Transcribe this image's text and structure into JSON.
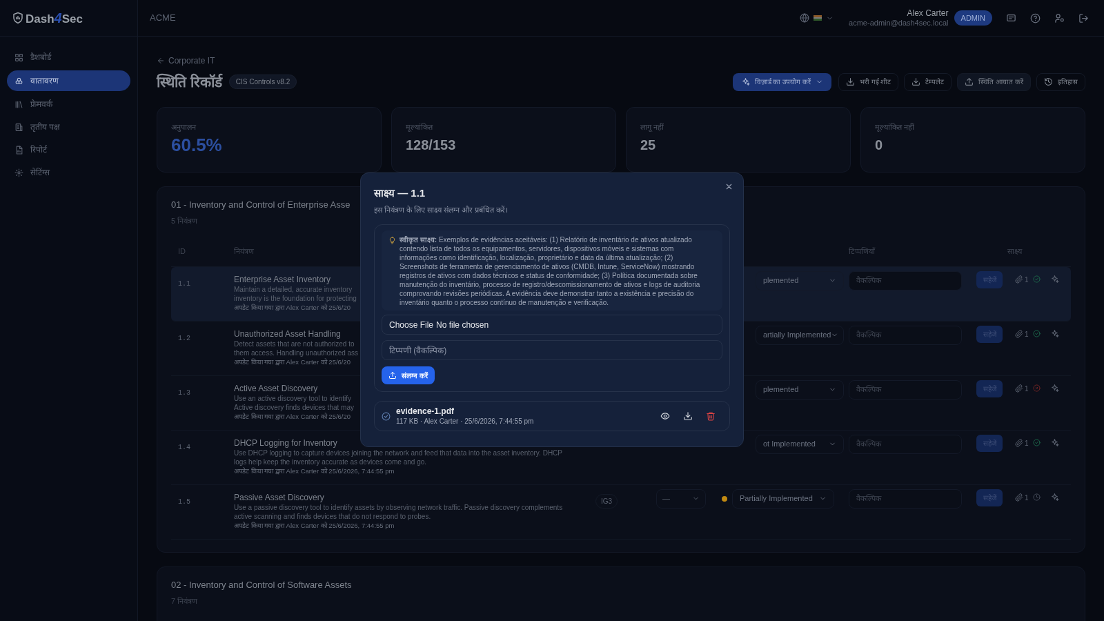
{
  "logo": {
    "prefix": "Dash",
    "mark": "4",
    "suffix": "Sec"
  },
  "organization": "ACME",
  "user": {
    "name": "Alex Carter",
    "email": "acme-admin@dash4sec.local",
    "role": "ADMIN"
  },
  "sidebar": {
    "items": [
      {
        "label": "डैशबोर्ड",
        "selected": false
      },
      {
        "label": "वातावरण",
        "selected": true
      },
      {
        "label": "फ्रेमवर्क",
        "selected": false
      },
      {
        "label": "तृतीय पक्ष",
        "selected": false
      },
      {
        "label": "रिपोर्ट",
        "selected": false
      },
      {
        "label": "सेटिंग्स",
        "selected": false
      }
    ]
  },
  "breadcrumb": "Corporate IT",
  "page_title": "स्थिति रिकॉर्ड",
  "framework_badge": "CIS Controls v8.2",
  "actions": [
    {
      "label": "विज़ार्ड का उपयोग करें",
      "kind": "wizard"
    },
    {
      "label": "भरी गई शीट",
      "kind": "download"
    },
    {
      "label": "टेम्पलेट",
      "kind": "download"
    },
    {
      "label": "स्थिति आयात करें",
      "kind": "upload"
    },
    {
      "label": "इतिहास",
      "kind": "history"
    }
  ],
  "stats": [
    {
      "label": "अनुपालन",
      "value": "60.5%",
      "kind": "accent"
    },
    {
      "label": "मूल्यांकित",
      "value": "128/153",
      "kind": "plain"
    },
    {
      "label": "लागू नहीं",
      "value": "25",
      "kind": "plain"
    },
    {
      "label": "मूल्यांकित नहीं",
      "value": "0",
      "kind": "plain"
    }
  ],
  "sections": [
    {
      "title": "01 - Inventory and Control of Enterprise Asse",
      "count": "5 नियंत्रण",
      "table": {
        "columns": [
          "ID",
          "नियंत्रण",
          "टिप्पणियाँ",
          "साक्ष्य"
        ],
        "rows": [
          {
            "id": "1.1",
            "title": "Enterprise Asset Inventory",
            "selected": true,
            "description_lines": [
              "Maintain a detailed, accurate inventory",
              "inventory is the foundation for protecting"
            ],
            "updated": "अपडेट किया गया द्वारा Alex Carter को 25/6/20",
            "status": "plemented",
            "comment_placeholder": "वैकल्पिक",
            "save": "सहेजें",
            "evidence": {
              "count": "1",
              "kind": "verified"
            }
          },
          {
            "id": "1.2",
            "title": "Unauthorized Asset Handling",
            "selected": false,
            "description_lines": [
              "Detect assets that are not authorized to",
              "them access. Handling unauthorized ass"
            ],
            "updated": "अपडेट किया गया द्वारा Alex Carter को 25/6/20",
            "status": "artially Implemented",
            "comment_placeholder": "वैकल्पिक",
            "save": "सहेजें",
            "evidence": {
              "count": "1",
              "kind": "verified"
            }
          },
          {
            "id": "1.3",
            "title": "Active Asset Discovery",
            "selected": false,
            "description_lines": [
              "Use an active discovery tool to identify",
              "Active discovery finds devices that may"
            ],
            "updated": "अपडेट किया गया द्वारा Alex Carter को 25/6/20",
            "status": "plemented",
            "comment_placeholder": "वैकल्पिक",
            "save": "सहेजें",
            "evidence": {
              "count": "1",
              "kind": "rejected"
            }
          },
          {
            "id": "1.4",
            "title": "DHCP Logging for Inventory",
            "selected": false,
            "description_lines": [
              "Use DHCP logging to capture devices joining the network and feed that data into the asset inventory. DHCP",
              "logs help keep the inventory accurate as devices come and go."
            ],
            "updated": "अपडेट किया गया द्वारा Alex Carter को 25/6/2026, 7:44:55 pm",
            "status": "ot Implemented",
            "comment_placeholder": "वैकल्पिक",
            "save": "सहेजें",
            "evidence": {
              "count": "1",
              "kind": "verified"
            }
          },
          {
            "id": "1.5",
            "title": "Passive Asset Discovery",
            "selected": false,
            "description_lines": [
              "Use a passive discovery tool to identify assets by observing network traffic. Passive discovery complements",
              "active scanning and finds devices that do not respond to probes."
            ],
            "updated": "अपडेट किया गया द्वारा Alex Carter को 25/6/2026, 7:44:55 pm",
            "ig": "IG3",
            "ig_select": "—",
            "color": "#c28a12",
            "status": "Partially Implemented",
            "comment_placeholder": "वैकल्पिक",
            "save": "सहेजें",
            "evidence": {
              "count": "1",
              "kind": "pending"
            }
          }
        ]
      }
    },
    {
      "title": "02 - Inventory and Control of Software Assets",
      "count": "7 नियंत्रण"
    }
  ],
  "modal": {
    "title": "साक्ष्य — 1.1",
    "subtitle": "इस नियंत्रण के लिए साक्ष्य संलग्न और प्रबंधित करें।",
    "hint": "**स्वीकृत साक्ष्य:** Exemplos de evidências aceitáveis: (1) Relatório de inventário de ativos atualizado contendo lista de todos os equipamentos, servidores, dispositivos móveis e sistemas com informações como identificação, localização, proprietário e data da última atualização; (2) Screenshots de ferramenta de gerenciamento de ativos (CMDB, Intune, ServiceNow) mostrando registros de ativos com dados técnicos e status de conformidade; (3) Política documentada sobre manutenção do inventário, processo de registro/descomissionamento de ativos e logs de auditoria comprovando revisões periódicas. A evidência deve demonstrar tanto a existência e precisão do inventário quanto o processo contínuo de manutenção e verificação.",
    "file_button": "Choose File",
    "file_status": "No file chosen",
    "comment_placeholder": "टिप्पणी (वैकल्पिक)",
    "attach": "संलग्न करें",
    "files": [
      {
        "name": "evidence-1.pdf",
        "meta": "117 KB · Alex Carter · 25/6/2026, 7:44:55 pm",
        "verified": true
      }
    ]
  }
}
